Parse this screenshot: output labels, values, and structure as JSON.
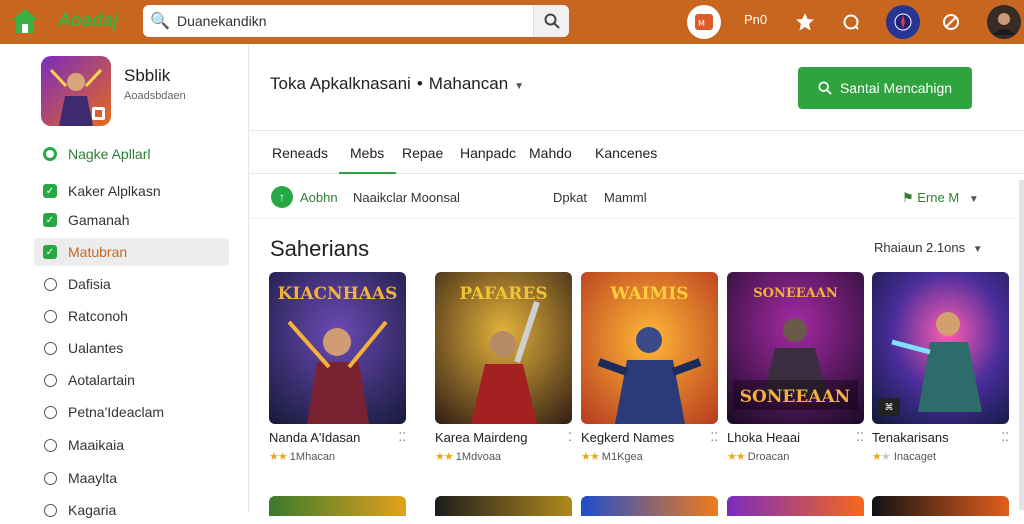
{
  "topbar": {
    "brand": "Aoadaj",
    "search_value": "Duanekandikn",
    "user_label": "Pn0"
  },
  "sidebar": {
    "app_name": "Sbblik",
    "app_sub": "Aoadsbdaen",
    "items": [
      {
        "label": "Nagke Apllarl",
        "icon": "ring-icon"
      },
      {
        "label": "Kaker Alplkasn",
        "icon": "check-icon"
      },
      {
        "label": "Gamanah",
        "icon": "check-icon"
      },
      {
        "label": "Matubran",
        "icon": "check-icon"
      },
      {
        "label": "Dafisia",
        "icon": "circle-icon"
      },
      {
        "label": "Ratconoh",
        "icon": "circle-icon"
      },
      {
        "label": "Ualantes",
        "icon": "circle-icon"
      },
      {
        "label": "Aotalartain",
        "icon": "circle-icon"
      },
      {
        "label": "Petna'Ideaclam",
        "icon": "circle-icon"
      },
      {
        "label": "Maaikaia",
        "icon": "circle-icon"
      },
      {
        "label": "Maaylta",
        "icon": "circle-icon"
      },
      {
        "label": "Kagaria",
        "icon": "circle-icon"
      }
    ]
  },
  "header": {
    "crumb_left": "Toka Apkalknasani",
    "crumb_sep": "•",
    "crumb_right": "Mahancan",
    "cta_label": "Santai Mencahign"
  },
  "tabs": [
    "Reneads",
    "Mebs",
    "Repae",
    "Hanpadc",
    "Mahdo",
    "Kancenes"
  ],
  "filter": {
    "label_a": "Aobhn",
    "label_b": "Naaikclar Moonsal",
    "label_c": "Dpkat",
    "label_d": "Mamml",
    "right": "Erne M"
  },
  "section": {
    "title": "Saherians",
    "sort": "Rhaiaun 2.1ons"
  },
  "cards": [
    {
      "title": "Nanda A'Idasan",
      "game_title": "KIACNHAAS",
      "rating": "1Mhacan",
      "title_color": "#f4b23a"
    },
    {
      "title": "Karea Mairdeng",
      "game_title": "PAFARES",
      "rating": "1Mdvoaa",
      "title_color": "#f1c232"
    },
    {
      "title": "Kegkerd Names",
      "game_title": "WAIMIS",
      "rating": "M1Kgea",
      "title_color": "#ffcf3a"
    },
    {
      "title": "Lhoka Heaai",
      "game_title": "SONEEAAN",
      "rating": "Droacan",
      "title_color": "#f4b23a"
    },
    {
      "title": "Tenakarisans",
      "game_title": "",
      "rating": "Inacaget",
      "title_color": "#ffffff"
    }
  ],
  "colors": {
    "topbar": "#c8661f",
    "accent_green": "#2fa33d",
    "active_orange": "#c8661f"
  }
}
